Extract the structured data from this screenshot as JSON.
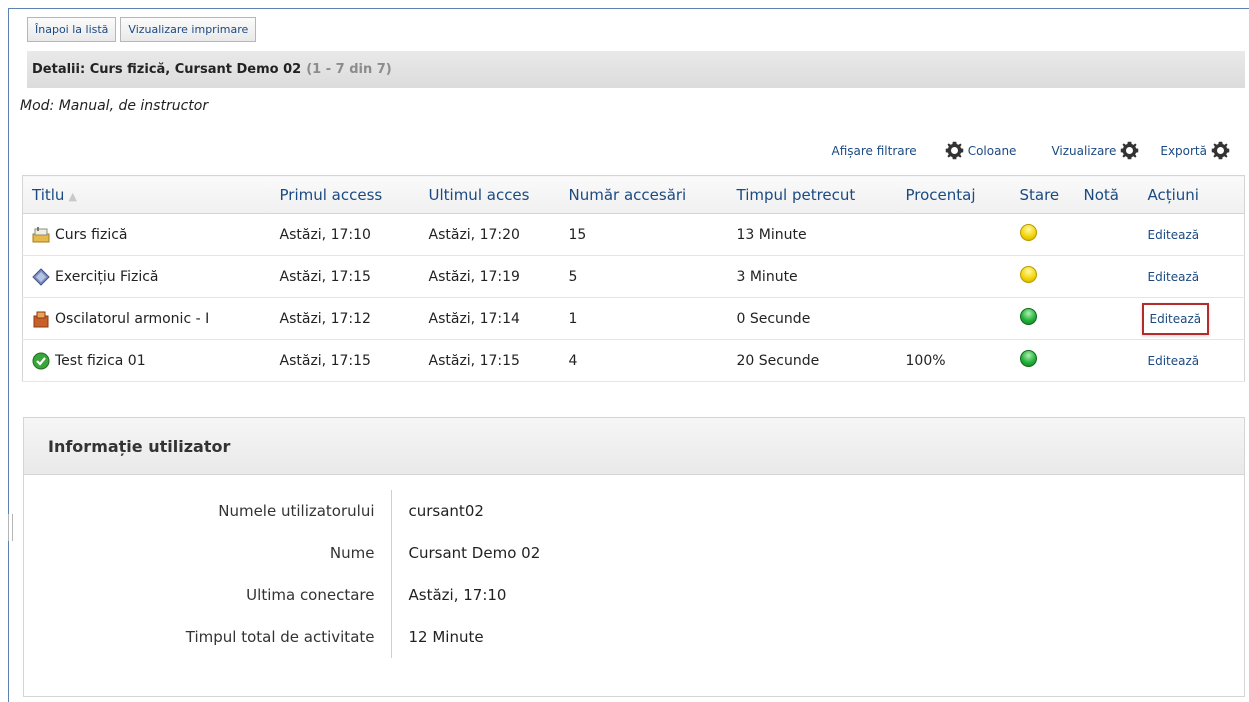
{
  "buttons": {
    "back": "Înapoi la listă",
    "print": "Vizualizare imprimare"
  },
  "details": {
    "label": "Detalii: Curs fizică, Cursant Demo 02",
    "range": "(1 - 7 din 7)"
  },
  "mode": "Mod: Manual, de instructor",
  "toolbar": {
    "filter": "Afișare filtrare",
    "columns": "Coloane",
    "view": "Vizualizare",
    "export": "Exportă"
  },
  "table": {
    "headers": {
      "title": "Titlu",
      "first": "Primul access",
      "last": "Ultimul acces",
      "count": "Număr accesări",
      "time": "Timpul petrecut",
      "percent": "Procentaj",
      "status": "Stare",
      "grade": "Notă",
      "actions": "Acțiuni"
    },
    "rows": [
      {
        "title": "Curs fizică",
        "first": "Astăzi, 17:10",
        "last": "Astăzi, 17:20",
        "count": "15",
        "time": "13 Minute",
        "percent": "",
        "status": "yellow",
        "grade": "",
        "action": "Editează",
        "icon": "course-icon"
      },
      {
        "title": "Exercițiu Fizică",
        "first": "Astăzi, 17:15",
        "last": "Astăzi, 17:19",
        "count": "5",
        "time": "3 Minute",
        "percent": "",
        "status": "yellow",
        "grade": "",
        "action": "Editează",
        "icon": "exercise-icon"
      },
      {
        "title": "Oscilatorul armonic - I",
        "first": "Astăzi, 17:12",
        "last": "Astăzi, 17:14",
        "count": "1",
        "time": "0 Secunde",
        "percent": "",
        "status": "green",
        "grade": "",
        "action": "Editează",
        "icon": "content-icon"
      },
      {
        "title": "Test fizica 01",
        "first": "Astăzi, 17:15",
        "last": "Astăzi, 17:15",
        "count": "4",
        "time": "20 Secunde",
        "percent": "100%",
        "status": "green",
        "grade": "",
        "action": "Editează",
        "icon": "test-check-icon"
      }
    ]
  },
  "user_info": {
    "title": "Informație utilizator",
    "rows": [
      {
        "label": "Numele utilizatorului",
        "value": "cursant02"
      },
      {
        "label": "Nume",
        "value": "Cursant Demo 02"
      },
      {
        "label": "Ultima conectare",
        "value": "Astăzi, 17:10"
      },
      {
        "label": "Timpul total de activitate",
        "value": "12 Minute"
      }
    ]
  },
  "colors": {
    "link": "#1b4a82",
    "highlight_border": "#b22c2c",
    "status_yellow": "#f2d200",
    "status_green": "#23b23b"
  }
}
